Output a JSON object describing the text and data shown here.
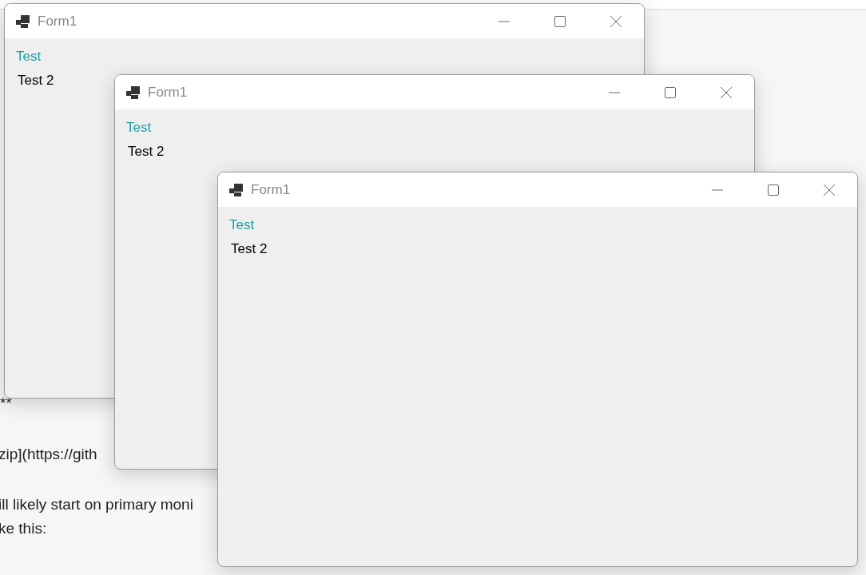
{
  "background_text": [
    {
      "text": "**"
    },
    {
      "text": "zip](https://gith"
    },
    {
      "text": "ill likely start on primary moni"
    },
    {
      "text": "ke this:"
    }
  ],
  "windows": [
    {
      "title": "Form1",
      "labels": [
        {
          "text": "Test",
          "color": "#1a9e9e"
        },
        {
          "text": "Test 2",
          "color": "#000000"
        }
      ]
    },
    {
      "title": "Form1",
      "labels": [
        {
          "text": "Test",
          "color": "#1a9e9e"
        },
        {
          "text": "Test 2",
          "color": "#000000"
        }
      ]
    },
    {
      "title": "Form1",
      "labels": [
        {
          "text": "Test",
          "color": "#1a9e9e"
        },
        {
          "text": "Test 2",
          "color": "#000000"
        }
      ]
    }
  ]
}
